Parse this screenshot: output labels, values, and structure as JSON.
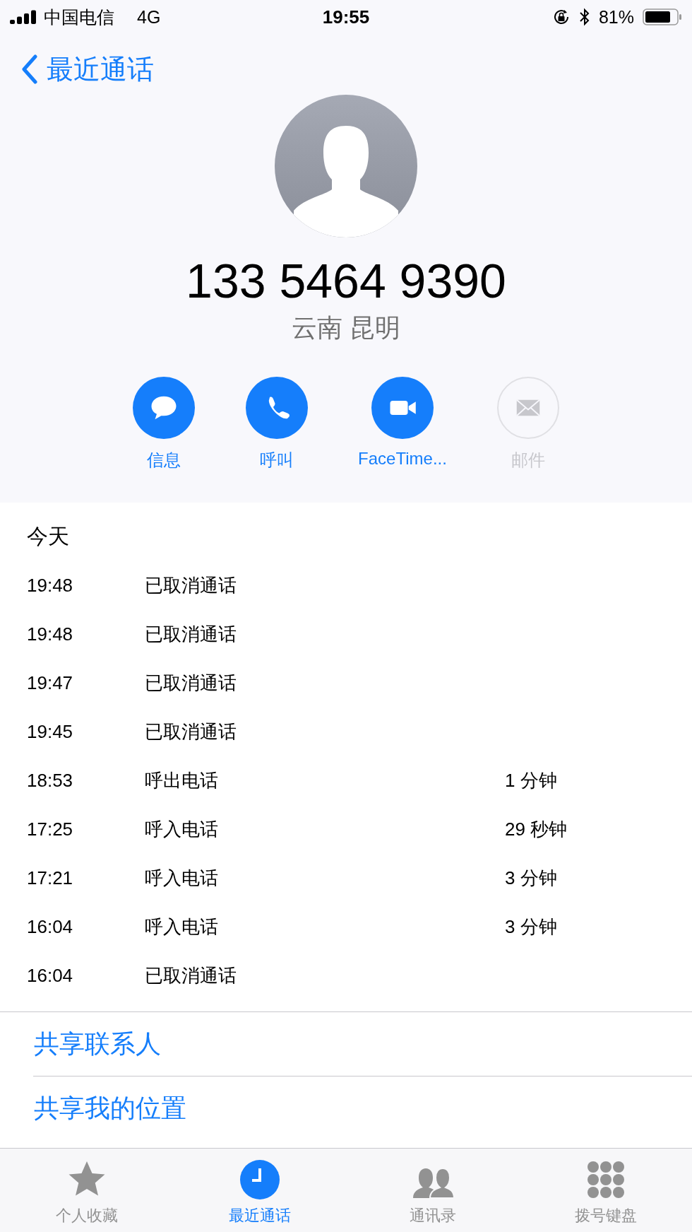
{
  "status_bar": {
    "carrier": "中国电信",
    "network": "4G",
    "time": "19:55",
    "battery": "81%"
  },
  "nav": {
    "back": "最近通话"
  },
  "contact": {
    "number": "133 5464 9390",
    "location": "云南 昆明"
  },
  "actions": [
    {
      "kind": "message",
      "label": "信息",
      "disabled": false
    },
    {
      "kind": "call",
      "label": "呼叫",
      "disabled": false
    },
    {
      "kind": "video",
      "label": "FaceTime...",
      "disabled": false
    },
    {
      "kind": "mail",
      "label": "邮件",
      "disabled": true
    }
  ],
  "history": {
    "heading": "今天",
    "rows": [
      {
        "time": "19:48",
        "type": "已取消通话"
      },
      {
        "time": "19:48",
        "type": "已取消通话"
      },
      {
        "time": "19:47",
        "type": "已取消通话"
      },
      {
        "time": "19:45",
        "type": "已取消通话"
      },
      {
        "time": "18:53",
        "type": "呼出电话",
        "duration": "1 分钟"
      },
      {
        "time": "17:25",
        "type": "呼入电话",
        "duration": "29 秒钟"
      },
      {
        "time": "17:21",
        "type": "呼入电话",
        "duration": "3 分钟"
      },
      {
        "time": "16:04",
        "type": "呼入电话",
        "duration": "3 分钟"
      },
      {
        "time": "16:04",
        "type": "已取消通话"
      }
    ]
  },
  "links": [
    "共享联系人",
    "共享我的位置"
  ],
  "tabs": [
    {
      "kind": "favorites",
      "label": "个人收藏",
      "selected": false
    },
    {
      "kind": "recents",
      "label": "最近通话",
      "selected": true
    },
    {
      "kind": "contacts",
      "label": "通讯录",
      "selected": false
    },
    {
      "kind": "keypad",
      "label": "拨号键盘",
      "selected": false
    }
  ]
}
